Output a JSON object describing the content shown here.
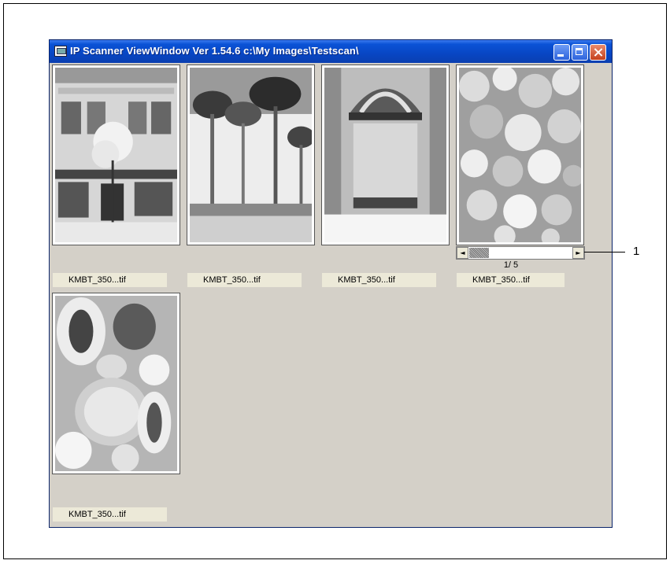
{
  "window": {
    "title": "IP Scanner ViewWindow Ver 1.54.6 c:\\My Images\\Testscan\\",
    "icons": {
      "app": "scanner-app-icon",
      "minimize": "minimize-icon",
      "maximize": "maximize-icon",
      "close": "close-icon"
    }
  },
  "thumbnails": [
    {
      "caption": "KMBT_350...tif",
      "subject": "building"
    },
    {
      "caption": "KMBT_350...tif",
      "subject": "palm-trees"
    },
    {
      "caption": "KMBT_350...tif",
      "subject": "awning-wall"
    },
    {
      "caption": "KMBT_350...tif",
      "subject": "fruit-pile"
    },
    {
      "caption": "KMBT_350...tif",
      "subject": "cut-fruit"
    }
  ],
  "pager": {
    "page_text": "1/ 5",
    "left_arrow": "◄",
    "right_arrow": "►"
  },
  "callout": {
    "label": "1"
  }
}
